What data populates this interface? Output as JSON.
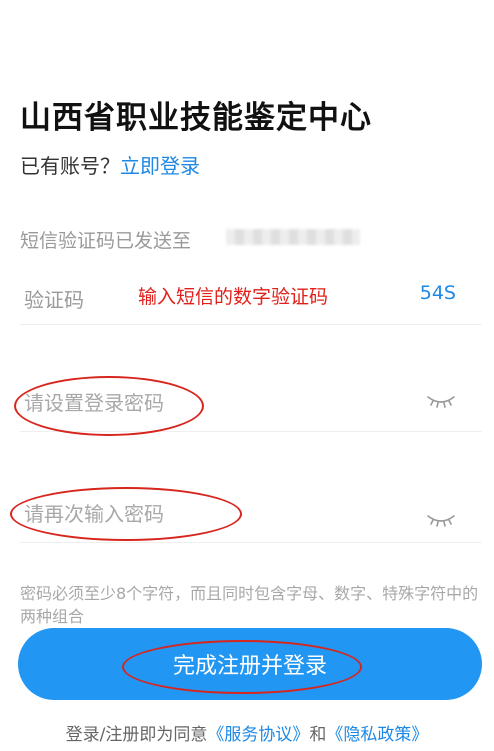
{
  "header": {
    "title": "山西省职业技能鉴定中心",
    "has_account_text": "已有账号？",
    "login_link": "立即登录"
  },
  "sms": {
    "sent_to_text": "短信验证码已发送至"
  },
  "code_field": {
    "label": "验证码",
    "value": "",
    "annotation": "输入短信的数字验证码",
    "countdown": "54S"
  },
  "password_field": {
    "placeholder": "请设置登录密码",
    "value": ""
  },
  "confirm_password_field": {
    "placeholder": "请再次输入密码",
    "value": ""
  },
  "hint": "密码必须至少8个字符，而且同时包含字母、数字、特殊字符中的两种组合",
  "submit": {
    "label": "完成注册并登录"
  },
  "agreement": {
    "prefix": "登录/注册即为同意",
    "service": "《服务协议》",
    "connector": "和",
    "privacy": "《隐私政策》"
  },
  "colors": {
    "accent": "#2196f3",
    "link": "#1e88e5",
    "annotation": "#e0201b"
  },
  "icons": {
    "password_toggle": "eye-closed-icon"
  }
}
